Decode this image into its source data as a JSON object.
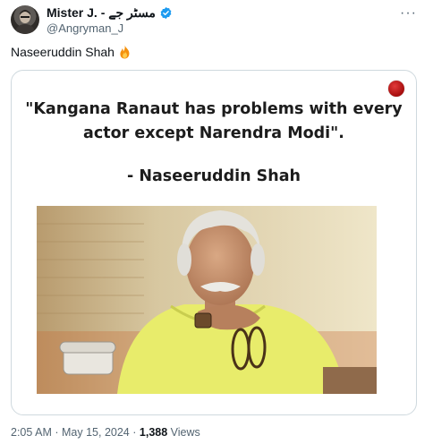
{
  "author": {
    "display_name": "Mister J. - مسٹر جے",
    "handle": "@Angryman_J",
    "verified_badge_color": "#1d9bf0"
  },
  "tweet": {
    "text": "Naseeruddin Shah",
    "emoji": "fire-emoji"
  },
  "card": {
    "quote_line1": "\"Kangana Ranaut has problems with every",
    "quote_line2": "actor except Narendra Modi\".",
    "attribution": "- Naseeruddin Shah"
  },
  "meta": {
    "time": "2:05 AM",
    "separator": "·",
    "date": "May 15, 2024",
    "views_count": "1,388",
    "views_label": "Views"
  },
  "icons": [
    "more-options-icon",
    "verified-badge-icon",
    "fire-emoji-icon"
  ],
  "more_label": "···"
}
